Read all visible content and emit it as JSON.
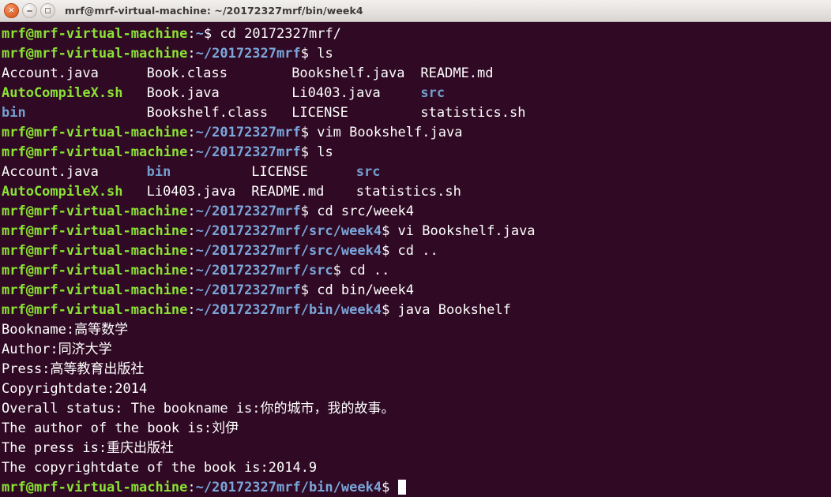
{
  "window": {
    "title": "mrf@mrf-virtual-machine: ~/20172327mrf/bin/week4",
    "buttons": {
      "close": "×",
      "minimize": "–",
      "maximize": "□"
    },
    "colors": {
      "background": "#300a24",
      "foreground": "#ffffff",
      "prompt_user": "#8ae234",
      "prompt_path": "#7aa6da",
      "dir": "#729fcf",
      "exec": "#8ae234",
      "titlebar": "#e8e5e2"
    }
  },
  "terminal": {
    "user_host": "mrf@mrf-virtual-machine",
    "lines": [
      {
        "type": "prompt",
        "path": "~",
        "command": "cd 20172327mrf/"
      },
      {
        "type": "prompt",
        "path": "~/20172327mrf",
        "command": "ls"
      },
      {
        "type": "ls",
        "cells": [
          {
            "text": "Account.java",
            "kind": "file",
            "col": 0
          },
          {
            "text": "Book.class",
            "kind": "file",
            "col": 18
          },
          {
            "text": "Bookshelf.java",
            "kind": "file",
            "col": 36
          },
          {
            "text": "README.md",
            "kind": "file",
            "col": 52
          }
        ]
      },
      {
        "type": "ls",
        "cells": [
          {
            "text": "AutoCompileX.sh",
            "kind": "exec",
            "col": 0
          },
          {
            "text": "Book.java",
            "kind": "file",
            "col": 18
          },
          {
            "text": "Li0403.java",
            "kind": "file",
            "col": 36
          },
          {
            "text": "src",
            "kind": "dir",
            "col": 52
          }
        ]
      },
      {
        "type": "ls",
        "cells": [
          {
            "text": "bin",
            "kind": "dir",
            "col": 0
          },
          {
            "text": "Bookshelf.class",
            "kind": "file",
            "col": 18
          },
          {
            "text": "LICENSE",
            "kind": "file",
            "col": 36
          },
          {
            "text": "statistics.sh",
            "kind": "file",
            "col": 52
          }
        ]
      },
      {
        "type": "prompt",
        "path": "~/20172327mrf",
        "command": "vim Bookshelf.java"
      },
      {
        "type": "prompt",
        "path": "~/20172327mrf",
        "command": "ls"
      },
      {
        "type": "ls",
        "cells": [
          {
            "text": "Account.java",
            "kind": "file",
            "col": 0
          },
          {
            "text": "bin",
            "kind": "dir",
            "col": 18
          },
          {
            "text": "LICENSE",
            "kind": "file",
            "col": 31
          },
          {
            "text": "src",
            "kind": "dir",
            "col": 44
          }
        ]
      },
      {
        "type": "ls",
        "cells": [
          {
            "text": "AutoCompileX.sh",
            "kind": "exec",
            "col": 0
          },
          {
            "text": "Li0403.java",
            "kind": "file",
            "col": 18
          },
          {
            "text": "README.md",
            "kind": "file",
            "col": 31
          },
          {
            "text": "statistics.sh",
            "kind": "file",
            "col": 44
          }
        ]
      },
      {
        "type": "prompt",
        "path": "~/20172327mrf",
        "command": "cd src/week4"
      },
      {
        "type": "prompt",
        "path": "~/20172327mrf/src/week4",
        "command": "vi Bookshelf.java"
      },
      {
        "type": "prompt",
        "path": "~/20172327mrf/src/week4",
        "command": "cd .."
      },
      {
        "type": "prompt",
        "path": "~/20172327mrf/src",
        "command": "cd .."
      },
      {
        "type": "prompt",
        "path": "~/20172327mrf",
        "command": "cd bin/week4"
      },
      {
        "type": "prompt",
        "path": "~/20172327mrf/bin/week4",
        "command": "java Bookshelf"
      },
      {
        "type": "output",
        "text": "Bookname:高等数学"
      },
      {
        "type": "output",
        "text": "Author:同济大学"
      },
      {
        "type": "output",
        "text": "Press:高等教育出版社"
      },
      {
        "type": "output",
        "text": "Copyrightdate:2014"
      },
      {
        "type": "output",
        "text": "Overall status: The bookname is:你的城市，我的故事。"
      },
      {
        "type": "output",
        "text": "The author of the book is:刘伊"
      },
      {
        "type": "output",
        "text": "The press is:重庆出版社"
      },
      {
        "type": "output",
        "text": "The copyrightdate of the book is:2014.9"
      },
      {
        "type": "prompt",
        "path": "~/20172327mrf/bin/week4",
        "command": "",
        "cursor": true
      }
    ]
  }
}
